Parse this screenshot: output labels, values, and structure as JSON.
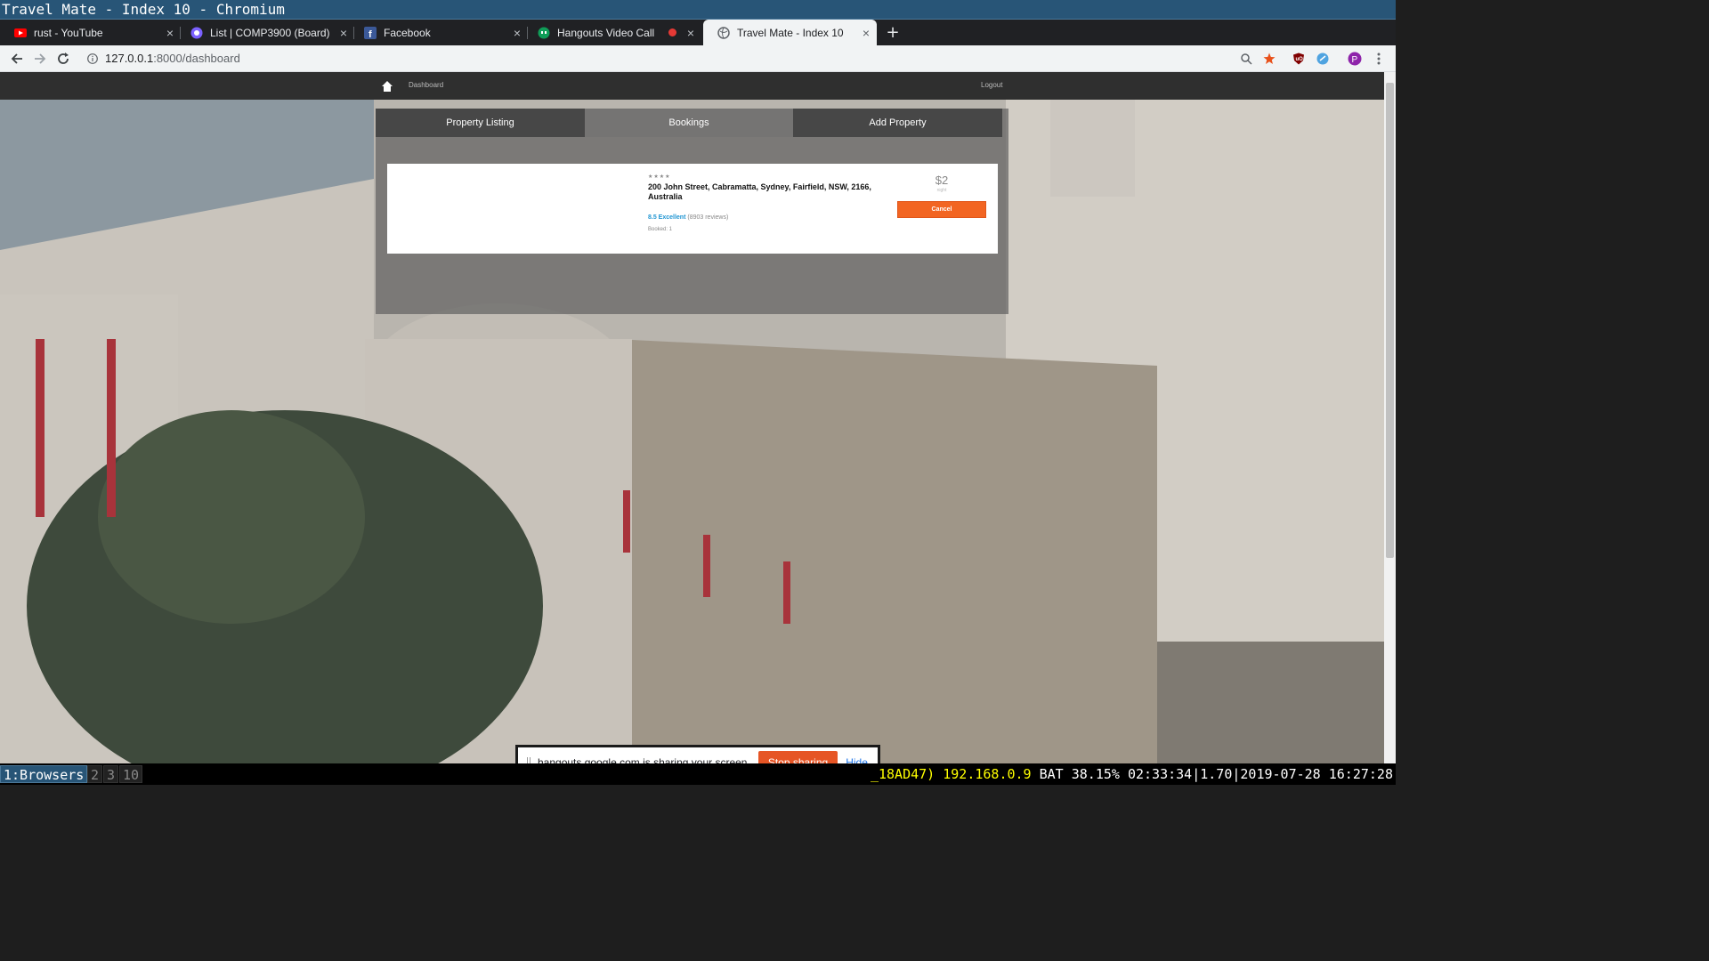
{
  "window": {
    "title": "Travel Mate - Index 10 - Chromium"
  },
  "tabs": [
    {
      "title": "rust - YouTube",
      "icon": "youtube-icon"
    },
    {
      "title": "List | COMP3900 (Board)",
      "icon": "board-icon"
    },
    {
      "title": "Facebook",
      "icon": "facebook-icon"
    },
    {
      "title": "Hangouts Video Call",
      "icon": "hangouts-icon"
    },
    {
      "title": "Travel Mate - Index 10",
      "icon": "globe-icon",
      "active": true
    }
  ],
  "toolbar": {
    "url_host": "127.0.0.1",
    "url_path": ":8000/dashboard"
  },
  "site": {
    "nav_dashboard": "Dashboard",
    "nav_logout": "Logout",
    "tabs": [
      "Property Listing",
      "Bookings",
      "Add Property"
    ],
    "active_tab": "Bookings"
  },
  "booking": {
    "stars": "★★★★",
    "address": "200 John Street, Cabramatta, Sydney, Fairfield, NSW, 2166, Australia",
    "score": "8.5 Excellent",
    "reviews": "(8903 reviews)",
    "booked": "Booked: 1",
    "price": "$2",
    "per": "night",
    "cancel_label": "Cancel"
  },
  "sharebar": {
    "message": "hangouts.google.com is sharing your screen.",
    "stop_label": "Stop sharing",
    "hide_label": "Hide"
  },
  "statusbar": {
    "workspaces": [
      "1:Browsers",
      "2",
      "3",
      "10"
    ],
    "net": "_18AD47) 192.168.0.9",
    "battery": "BAT 38.15% 02:33:34",
    "load": "1.70",
    "datetime": "2019-07-28 16:27:28"
  },
  "colors": {
    "accent": "#f26522",
    "rating": "#2196d3",
    "wm_focus": "#285577"
  }
}
